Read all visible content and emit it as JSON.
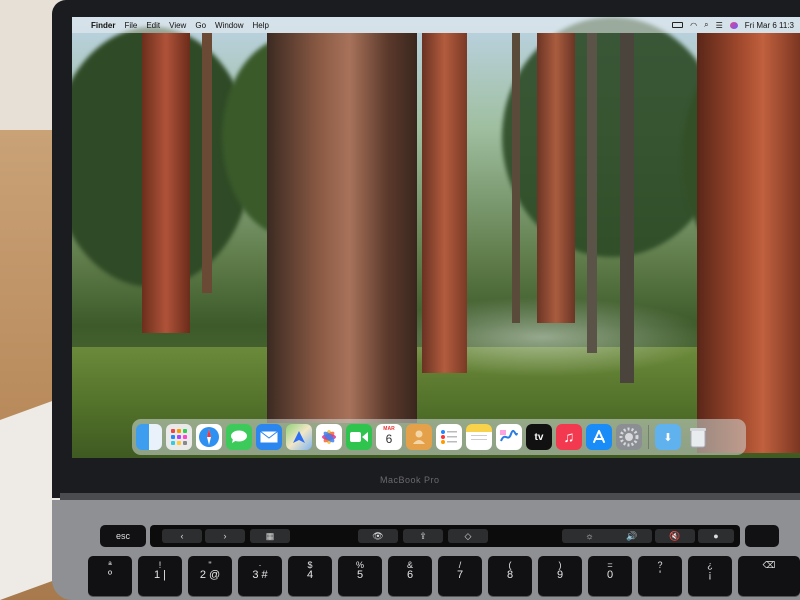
{
  "menubar": {
    "apple": "",
    "app": "Finder",
    "menus": [
      "File",
      "Edit",
      "View",
      "Go",
      "Window",
      "Help"
    ],
    "datetime": "Fri Mar 6  11:3",
    "status_icons": [
      "battery-icon",
      "wifi-icon",
      "search-icon",
      "control-center-icon",
      "siri-icon"
    ]
  },
  "dock": {
    "apps": [
      "finder-icon",
      "launchpad-icon",
      "safari-icon",
      "messages-icon",
      "mail-icon",
      "maps-icon",
      "photos-icon",
      "facetime-icon",
      "calendar-icon",
      "contacts-icon",
      "reminders-icon",
      "notes-icon",
      "freeform-icon",
      "tv-icon",
      "music-icon",
      "app-store-icon",
      "system-settings-icon"
    ],
    "calendar_month": "MAR",
    "calendar_day": "6",
    "tv_label": "tv",
    "trailing": [
      "downloads-folder-icon",
      "trash-icon"
    ]
  },
  "laptop": {
    "logo": "MacBook Pro"
  },
  "keyboard": {
    "esc": "esc",
    "number_row": [
      {
        "top": "ª",
        "bot": "º"
      },
      {
        "top": "!",
        "bot": "1 |"
      },
      {
        "top": "\"",
        "bot": "2 @"
      },
      {
        "top": "·",
        "bot": "3 #"
      },
      {
        "top": "$",
        "bot": "4"
      },
      {
        "top": "%",
        "bot": "5"
      },
      {
        "top": "&",
        "bot": "6"
      },
      {
        "top": "/",
        "bot": "7"
      },
      {
        "top": "(",
        "bot": "8"
      },
      {
        "top": ")",
        "bot": "9"
      },
      {
        "top": "=",
        "bot": "0"
      },
      {
        "top": "?",
        "bot": "'"
      },
      {
        "top": "¿",
        "bot": "¡"
      }
    ]
  },
  "colors": {
    "messages": "#3ccb5a",
    "mail": "#2b86ef",
    "safari": "#2e90f0",
    "facetime": "#2ec44e",
    "music": "#f2394f",
    "appstore": "#1a8cf7",
    "tv": "#111111",
    "notes": "#f7d24a"
  }
}
